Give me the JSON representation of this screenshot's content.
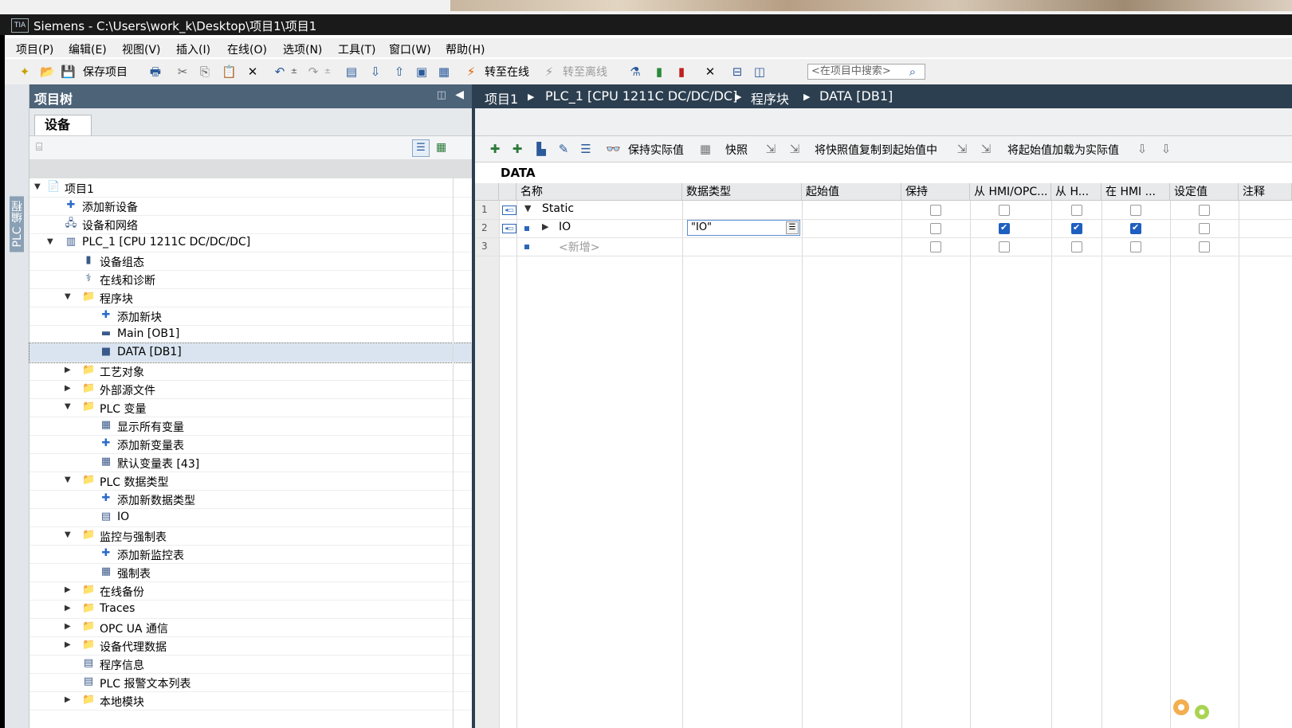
{
  "window": {
    "title": "Siemens  -  C:\\Users\\work_k\\Desktop\\项目1\\项目1",
    "logo": "TIA"
  },
  "menu": [
    "项目(P)",
    "编辑(E)",
    "视图(V)",
    "插入(I)",
    "在线(O)",
    "选项(N)",
    "工具(T)",
    "窗口(W)",
    "帮助(H)"
  ],
  "toolbar": {
    "save_label": "保存项目",
    "go_online": "转至在线",
    "go_offline": "转至离线",
    "search_placeholder": "<在项目中搜索>"
  },
  "sidebar_tab": "PLC 编程",
  "project_tree": {
    "title": "项目树",
    "tab": "设备",
    "items": [
      {
        "label": "项目1",
        "icon": "📄",
        "level": 0,
        "arrow": "▼"
      },
      {
        "label": "添加新设备",
        "icon": "✚",
        "level": 1,
        "arrow": ""
      },
      {
        "label": "设备和网络",
        "icon": "🖧",
        "level": 1,
        "arrow": ""
      },
      {
        "label": "PLC_1 [CPU 1211C DC/DC/DC]",
        "icon": "▥",
        "level": 1,
        "arrow": "▼"
      },
      {
        "label": "设备组态",
        "icon": "▮",
        "level": 2,
        "arrow": ""
      },
      {
        "label": "在线和诊断",
        "icon": "⚕",
        "level": 2,
        "arrow": ""
      },
      {
        "label": "程序块",
        "icon": "📁",
        "level": 2,
        "arrow": "▼"
      },
      {
        "label": "添加新块",
        "icon": "✚",
        "level": 3,
        "arrow": ""
      },
      {
        "label": "Main [OB1]",
        "icon": "▬",
        "level": 3,
        "arrow": ""
      },
      {
        "label": "DATA [DB1]",
        "icon": "■",
        "level": 3,
        "arrow": "",
        "selected": true
      },
      {
        "label": "工艺对象",
        "icon": "📁",
        "level": 2,
        "arrow": "▶"
      },
      {
        "label": "外部源文件",
        "icon": "📁",
        "level": 2,
        "arrow": "▶"
      },
      {
        "label": "PLC 变量",
        "icon": "📁",
        "level": 2,
        "arrow": "▼"
      },
      {
        "label": "显示所有变量",
        "icon": "▦",
        "level": 3,
        "arrow": ""
      },
      {
        "label": "添加新变量表",
        "icon": "✚",
        "level": 3,
        "arrow": ""
      },
      {
        "label": "默认变量表 [43]",
        "icon": "▦",
        "level": 3,
        "arrow": ""
      },
      {
        "label": "PLC 数据类型",
        "icon": "📁",
        "level": 2,
        "arrow": "▼"
      },
      {
        "label": "添加新数据类型",
        "icon": "✚",
        "level": 3,
        "arrow": ""
      },
      {
        "label": "IO",
        "icon": "▤",
        "level": 3,
        "arrow": ""
      },
      {
        "label": "监控与强制表",
        "icon": "📁",
        "level": 2,
        "arrow": "▼"
      },
      {
        "label": "添加新监控表",
        "icon": "✚",
        "level": 3,
        "arrow": ""
      },
      {
        "label": "强制表",
        "icon": "▦",
        "level": 3,
        "arrow": ""
      },
      {
        "label": "在线备份",
        "icon": "📁",
        "level": 2,
        "arrow": "▶"
      },
      {
        "label": "Traces",
        "icon": "📁",
        "level": 2,
        "arrow": "▶"
      },
      {
        "label": "OPC UA 通信",
        "icon": "📁",
        "level": 2,
        "arrow": "▶"
      },
      {
        "label": "设备代理数据",
        "icon": "📁",
        "level": 2,
        "arrow": "▶"
      },
      {
        "label": "程序信息",
        "icon": "▤",
        "level": 2,
        "arrow": ""
      },
      {
        "label": "PLC 报警文本列表",
        "icon": "▤",
        "level": 2,
        "arrow": ""
      },
      {
        "label": "本地模块",
        "icon": "📁",
        "level": 2,
        "arrow": "▶"
      }
    ]
  },
  "breadcrumb": [
    "项目1",
    "PLC_1 [CPU 1211C DC/DC/DC]",
    "程序块",
    "DATA [DB1]"
  ],
  "editor_toolbar": {
    "keep_actual": "保持实际值",
    "snapshot": "快照",
    "copy_snapshot": "将快照值复制到起始值中",
    "load_start": "将起始值加载为实际值"
  },
  "db_title": "DATA",
  "table": {
    "headers": [
      "名称",
      "数据类型",
      "起始值",
      "保持",
      "从 HMI/OPC...",
      "从 H...",
      "在 HMI ...",
      "设定值",
      "注释"
    ],
    "rows": [
      {
        "num": "1",
        "name": "Static",
        "type": "",
        "checks": [
          false,
          false,
          false,
          false,
          false
        ]
      },
      {
        "num": "2",
        "name": "IO",
        "type": "\"IO\"",
        "checks": [
          false,
          true,
          true,
          true,
          false
        ]
      },
      {
        "num": "3",
        "name": "<新增>",
        "type": "",
        "checks": [
          false,
          false,
          false,
          false,
          false
        ]
      }
    ]
  },
  "colors": {
    "title_bar": "#1a1a1a",
    "panel_header": "#4d6378",
    "breadcrumb_bg": "#2c3f50",
    "checkbox_on": "#1f5fbf"
  }
}
